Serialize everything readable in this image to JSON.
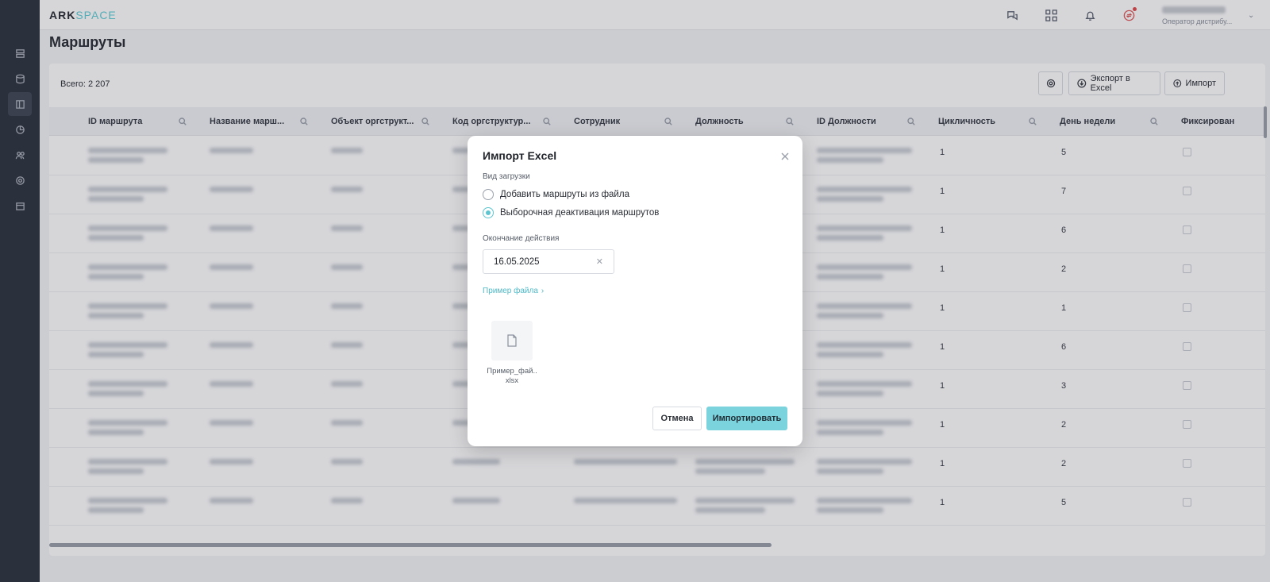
{
  "app": {
    "logo_ark": "ARK",
    "logo_space": "SPACE"
  },
  "user": {
    "role": "Оператор дистрибу..."
  },
  "page": {
    "title": "Маршруты"
  },
  "toolbar": {
    "total": "Всего: 2 207",
    "export_label": "Экспорт в Excel",
    "import_label": "Импорт"
  },
  "table": {
    "columns": [
      "ID маршрута",
      "Название марш...",
      "Объект оргструкт...",
      "Код оргструктур...",
      "Сотрудник",
      "Должность",
      "ID Должности",
      "Цикличность",
      "День недели",
      "Фиксирован"
    ],
    "rows": [
      {
        "cycle": "1",
        "day": "5"
      },
      {
        "cycle": "1",
        "day": "7"
      },
      {
        "cycle": "1",
        "day": "6"
      },
      {
        "cycle": "1",
        "day": "2"
      },
      {
        "cycle": "1",
        "day": "1"
      },
      {
        "cycle": "1",
        "day": "6"
      },
      {
        "cycle": "1",
        "day": "3"
      },
      {
        "cycle": "1",
        "day": "2"
      },
      {
        "cycle": "1",
        "day": "2"
      },
      {
        "cycle": "1",
        "day": "5"
      }
    ]
  },
  "modal": {
    "title": "Импорт Excel",
    "load_type_label": "Вид загрузки",
    "option_add": "Добавить маршруты из файла",
    "option_deactivate": "Выборочная деактивация маршрутов",
    "selected_option": "option_deactivate",
    "end_label": "Окончание действия",
    "end_date": "16.05.2025",
    "sample_link": "Пример файла",
    "file_name_line1": "Пример_фай..",
    "file_name_line2": "xlsx",
    "cancel": "Отмена",
    "import": "Импортировать"
  },
  "colors": {
    "accent": "#5ec5d0",
    "import_button": "#7bd3dd",
    "sidebar": "#2f3541"
  }
}
